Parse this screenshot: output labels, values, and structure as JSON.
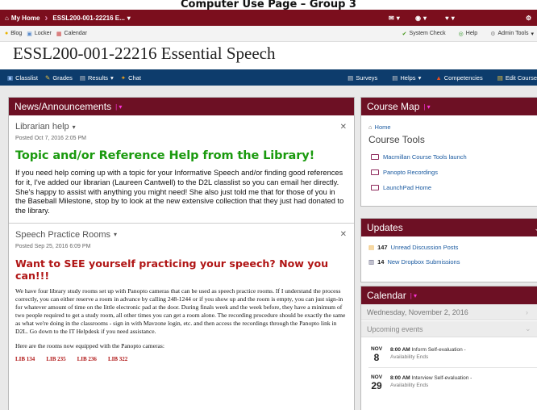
{
  "page_heading": "Computer Use Page – Group 3",
  "topnav": {
    "home_label": "My Home",
    "course_label": "ESSL200-001-22216 E...",
    "colors": {
      "bar": "#7b0e1d"
    }
  },
  "minibar": {
    "blog": "Blog",
    "locker": "Locker",
    "calendar": "Calendar",
    "system_check": "System Check",
    "help": "Help",
    "admin_tools": "Admin Tools"
  },
  "course_title": "ESSL200-001-22216 Essential Speech",
  "navbar": {
    "items": [
      "Classlist",
      "Grades",
      "Results",
      "Chat"
    ],
    "right": [
      "Surveys",
      "Helps",
      "Competencies",
      "Edit Course"
    ]
  },
  "news": {
    "header": "News/Announcements",
    "item1": {
      "title": "Librarian help",
      "posted": "Posted Oct 7, 2016 2:05 PM",
      "headline": "Topic and/or Reference Help from the Library!",
      "body": "If you need help coming up with a topic for your Informative Speech and/or finding good references for it, I've added our librarian (Laureen Cantwell) to the D2L classlist so you can email her directly.  She's happy to assist with anything you might need!  She also just told me that for those of you in the Baseball Milestone, stop by to look at the new extensive collection that they just had donated to the library."
    },
    "item2": {
      "title": "Speech Practice Rooms",
      "posted": "Posted Sep 25, 2016 6:09 PM",
      "headline": "Want to SEE yourself practicing your speech?  Now you can!!!",
      "body": "We have four library study rooms set up with Panopto cameras that can be used as speech practice rooms.  If I understand the process correctly, you can either reserve a room in advance by calling 248-1244 or if you show up and the room is empty, you can just sign-in for whatever amount of time on the little electronic pad at the door.  During finals week and the week before, they have a minimum of two people required to get a study room, all other times you can get a room alone.  The recording procedure should be exactly the same as what we're doing in the classrooms - sign in with Mavzone login, etc. and then access the recordings through the Panopto link in D2L.  Go down to the IT Helpdesk if you need assistance.",
      "rooms_intro": "Here are the rooms now equipped with the Panopto cameras:",
      "rooms": [
        "LIB 134",
        "LIB 235",
        "LIB 236",
        "LIB 322"
      ]
    }
  },
  "course_map": {
    "header": "Course Map",
    "home": "Home",
    "tools_heading": "Course Tools",
    "links": [
      "Macmillan Course Tools launch",
      "Panopto Recordings",
      "LaunchPad Home"
    ]
  },
  "updates": {
    "header": "Updates",
    "rows": [
      {
        "count": "147",
        "label": "Unread Discussion Posts"
      },
      {
        "count": "14",
        "label": "New Dropbox Submissions"
      }
    ]
  },
  "calendar": {
    "header": "Calendar",
    "date": "Wednesday, November 2, 2016",
    "upcoming": "Upcoming events",
    "events": [
      {
        "month": "NOV",
        "day": "8",
        "time": "8:00 AM",
        "title": "Inform Self-evaluation -",
        "sub": "Availability Ends"
      },
      {
        "month": "NOV",
        "day": "29",
        "time": "8:00 AM",
        "title": "Interview Self-evaluation -",
        "sub": "Availability Ends"
      }
    ]
  },
  "colors": {
    "widget_header": "#6d1024",
    "green_headline": "#1a9a0e",
    "red_headline": "#b01515",
    "link_blue": "#1a5aa0",
    "arrow_blue": "#1565c0"
  }
}
